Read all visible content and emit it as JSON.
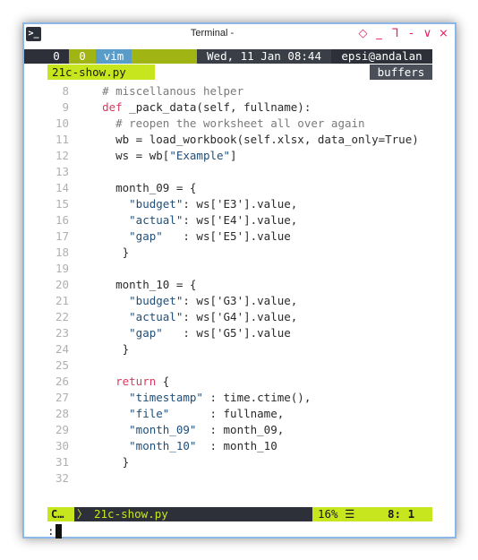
{
  "window": {
    "title": "Terminal -",
    "controls": [
      "◇",
      "_",
      "ᒣ",
      "-",
      "∨",
      "⨯"
    ]
  },
  "tmux": {
    "window_index": "0",
    "session": "0",
    "app": "vim",
    "datetime": "Wed, 11 Jan 08:44",
    "host": "epsi@andalan"
  },
  "tabline": {
    "active_tab": "21c-show.py",
    "buffers_label": "buffers"
  },
  "code_lines": [
    {
      "n": "8",
      "segs": [
        {
          "t": "  ",
          "c": "normal"
        },
        {
          "t": "# miscellanous helper",
          "c": "comment"
        }
      ]
    },
    {
      "n": "9",
      "segs": [
        {
          "t": "  ",
          "c": "normal"
        },
        {
          "t": "def",
          "c": "keyword"
        },
        {
          "t": " _pack_data(self, fullname):",
          "c": "normal"
        }
      ]
    },
    {
      "n": "10",
      "segs": [
        {
          "t": "    ",
          "c": "normal"
        },
        {
          "t": "# reopen the worksheet all over again",
          "c": "comment"
        }
      ]
    },
    {
      "n": "11",
      "segs": [
        {
          "t": "    wb = load_workbook(self.xlsx, data_only=True)",
          "c": "normal"
        }
      ]
    },
    {
      "n": "12",
      "segs": [
        {
          "t": "    ws = wb[",
          "c": "normal"
        },
        {
          "t": "\"Example\"",
          "c": "string"
        },
        {
          "t": "]",
          "c": "normal"
        }
      ]
    },
    {
      "n": "13",
      "segs": [
        {
          "t": "",
          "c": "normal"
        }
      ]
    },
    {
      "n": "14",
      "segs": [
        {
          "t": "    month_09 = {",
          "c": "normal"
        }
      ]
    },
    {
      "n": "15",
      "segs": [
        {
          "t": "      ",
          "c": "normal"
        },
        {
          "t": "\"budget\"",
          "c": "string"
        },
        {
          "t": ": ws['E3'].value,",
          "c": "normal"
        }
      ]
    },
    {
      "n": "16",
      "segs": [
        {
          "t": "      ",
          "c": "normal"
        },
        {
          "t": "\"actual\"",
          "c": "string"
        },
        {
          "t": ": ws['E4'].value,",
          "c": "normal"
        }
      ]
    },
    {
      "n": "17",
      "segs": [
        {
          "t": "      ",
          "c": "normal"
        },
        {
          "t": "\"gap\"",
          "c": "string"
        },
        {
          "t": "   : ws['E5'].value",
          "c": "normal"
        }
      ]
    },
    {
      "n": "18",
      "segs": [
        {
          "t": "     }",
          "c": "normal"
        }
      ]
    },
    {
      "n": "19",
      "segs": [
        {
          "t": "",
          "c": "normal"
        }
      ]
    },
    {
      "n": "20",
      "segs": [
        {
          "t": "    month_10 = {",
          "c": "normal"
        }
      ]
    },
    {
      "n": "21",
      "segs": [
        {
          "t": "      ",
          "c": "normal"
        },
        {
          "t": "\"budget\"",
          "c": "string"
        },
        {
          "t": ": ws['G3'].value,",
          "c": "normal"
        }
      ]
    },
    {
      "n": "22",
      "segs": [
        {
          "t": "      ",
          "c": "normal"
        },
        {
          "t": "\"actual\"",
          "c": "string"
        },
        {
          "t": ": ws['G4'].value,",
          "c": "normal"
        }
      ]
    },
    {
      "n": "23",
      "segs": [
        {
          "t": "      ",
          "c": "normal"
        },
        {
          "t": "\"gap\"",
          "c": "string"
        },
        {
          "t": "   : ws['G5'].value",
          "c": "normal"
        }
      ]
    },
    {
      "n": "24",
      "segs": [
        {
          "t": "     }",
          "c": "normal"
        }
      ]
    },
    {
      "n": "25",
      "segs": [
        {
          "t": "",
          "c": "normal"
        }
      ]
    },
    {
      "n": "26",
      "segs": [
        {
          "t": "    ",
          "c": "normal"
        },
        {
          "t": "return",
          "c": "keyword"
        },
        {
          "t": " {",
          "c": "normal"
        }
      ]
    },
    {
      "n": "27",
      "segs": [
        {
          "t": "      ",
          "c": "normal"
        },
        {
          "t": "\"timestamp\"",
          "c": "string"
        },
        {
          "t": " : time.ctime(),",
          "c": "normal"
        }
      ]
    },
    {
      "n": "28",
      "segs": [
        {
          "t": "      ",
          "c": "normal"
        },
        {
          "t": "\"file\"",
          "c": "string"
        },
        {
          "t": "      : fullname,",
          "c": "normal"
        }
      ]
    },
    {
      "n": "29",
      "segs": [
        {
          "t": "      ",
          "c": "normal"
        },
        {
          "t": "\"month_09\"",
          "c": "string"
        },
        {
          "t": "  : month_09,",
          "c": "normal"
        }
      ]
    },
    {
      "n": "30",
      "segs": [
        {
          "t": "      ",
          "c": "normal"
        },
        {
          "t": "\"month_10\"",
          "c": "string"
        },
        {
          "t": "  : month_10",
          "c": "normal"
        }
      ]
    },
    {
      "n": "31",
      "segs": [
        {
          "t": "     }",
          "c": "normal"
        }
      ]
    },
    {
      "n": "32",
      "segs": [
        {
          "t": "",
          "c": "normal"
        }
      ]
    }
  ],
  "statusline": {
    "mode": "C…",
    "separator": "〉",
    "filename": "21c-show.py",
    "percent": "16% ☰",
    "position": "8:  1"
  },
  "cmdline": {
    "prompt": ":"
  },
  "colors": {
    "accent": "#c8e61e",
    "bar_dark": "#2d3038",
    "keyword": "#d63b5f",
    "window_border": "#8cb8e8"
  }
}
